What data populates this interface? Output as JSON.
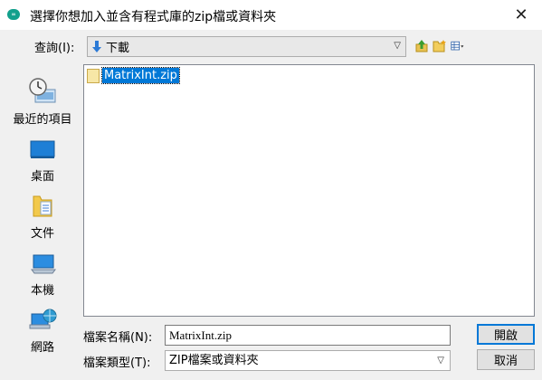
{
  "window": {
    "title": "選擇你想加入並含有程式庫的zip檔或資料夾",
    "app_icon_text": "∞",
    "close_glyph": "✕"
  },
  "lookin": {
    "label": "查詢(I):",
    "current_folder": "下載",
    "dropdown_glyph": "▽"
  },
  "toolbar": {
    "up_icon": "up-folder-icon",
    "new_folder_icon": "new-folder-icon",
    "view_menu_icon": "view-menu-icon"
  },
  "places": [
    {
      "label": "最近的項目",
      "icon": "recent-items-icon"
    },
    {
      "label": "桌面",
      "icon": "desktop-icon"
    },
    {
      "label": "文件",
      "icon": "documents-icon"
    },
    {
      "label": "本機",
      "icon": "computer-icon"
    },
    {
      "label": "網路",
      "icon": "network-icon"
    }
  ],
  "files": [
    {
      "name": "MatrixInt.zip",
      "selected": true
    }
  ],
  "filename": {
    "label": "檔案名稱(N):",
    "value": "MatrixInt.zip"
  },
  "filetype": {
    "label": "檔案類型(T):",
    "value": "ZIP檔案或資料夾",
    "dropdown_glyph": "▽"
  },
  "buttons": {
    "open": "開啟",
    "cancel": "取消"
  },
  "colors": {
    "selection": "#0078d7",
    "app_icon": "#12a08c",
    "folder_arrow": "#2b7ad6"
  }
}
